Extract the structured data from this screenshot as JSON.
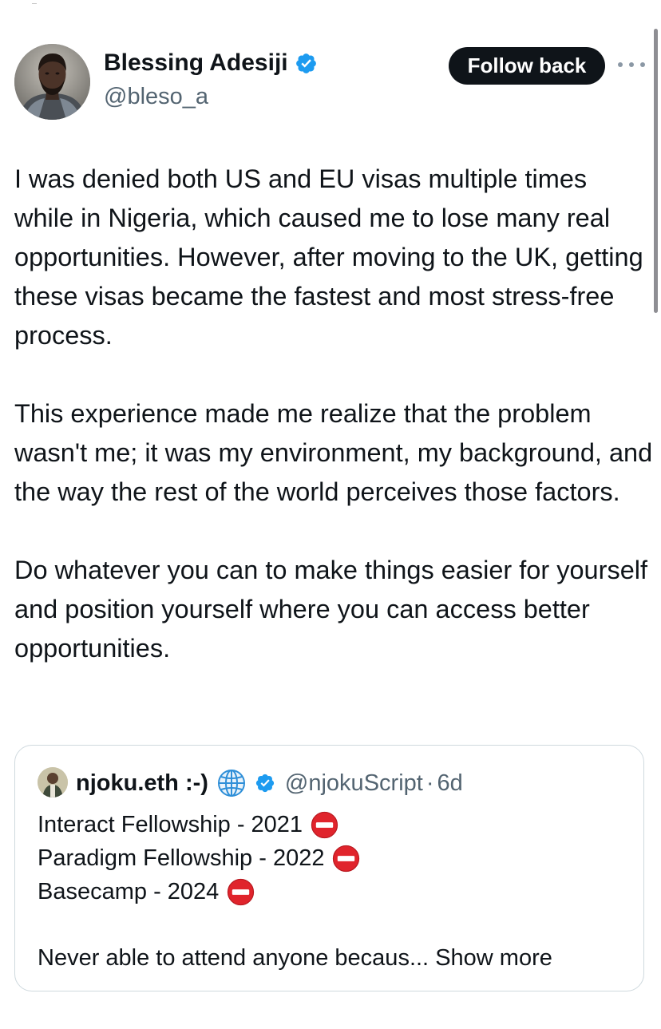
{
  "author": {
    "name": "Blessing Adesiji",
    "handle": "@bleso_a",
    "verified": true,
    "avatar_icon": "avatar-portrait"
  },
  "actions": {
    "follow_label": "Follow back",
    "more_icon": "more-horizontal-icon"
  },
  "post": {
    "paragraphs": [
      "I was denied both US and EU visas multiple times while in Nigeria, which caused me to lose many real opportunities. However, after moving to the UK, getting these visas became the fastest and most stress-free process.",
      "This experience made me realize that the problem wasn't me; it was my environment, my background, and the way the rest of the world perceives those factors.",
      "Do whatever you can to make things easier for yourself and position yourself where you can access better opportunities."
    ]
  },
  "quote": {
    "name": "njoku.eth :-)",
    "name_emoji": "globe-icon",
    "verified": true,
    "handle": "@njokuScript",
    "separator": "·",
    "time": "6d",
    "lines": [
      "Interact Fellowship - 2021",
      "Paradigm Fellowship - 2022",
      "Basecamp - 2024"
    ],
    "line_emoji": "no-entry-icon",
    "snippet": "Never able to attend anyone becaus...",
    "show_more_label": "Show more"
  },
  "colors": {
    "text": "#0f1419",
    "secondary": "#536471",
    "verified_blue": "#1d9bf0",
    "button_bg": "#0f1419",
    "border": "#cfd9de",
    "no_entry_red": "#e0242c"
  }
}
